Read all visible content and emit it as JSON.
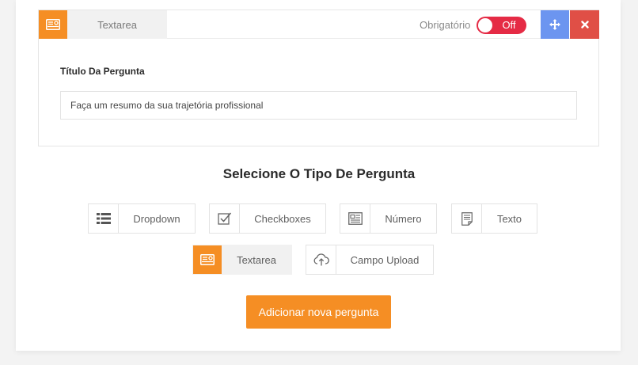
{
  "question": {
    "type_label": "Textarea",
    "required_label": "Obrigatório",
    "toggle_label": "Off",
    "title_label": "Título Da Pergunta",
    "input_value": "Faça um resumo da sua trajetória profissional"
  },
  "selector": {
    "title": "Selecione O Tipo De Pergunta",
    "types": [
      {
        "label": "Dropdown",
        "icon": "list-icon"
      },
      {
        "label": "Checkboxes",
        "icon": "checkbox-icon"
      },
      {
        "label": "Número",
        "icon": "number-icon"
      },
      {
        "label": "Texto",
        "icon": "document-icon"
      },
      {
        "label": "Textarea",
        "icon": "textarea-icon",
        "active": true
      },
      {
        "label": "Campo Upload",
        "icon": "cloud-upload-icon"
      }
    ]
  },
  "add_button_label": "Adicionar nova pergunta",
  "colors": {
    "accent": "#f58e24",
    "toggle_off": "#e52b45",
    "move_button": "#6c95f0",
    "delete_button": "#e04f46"
  }
}
